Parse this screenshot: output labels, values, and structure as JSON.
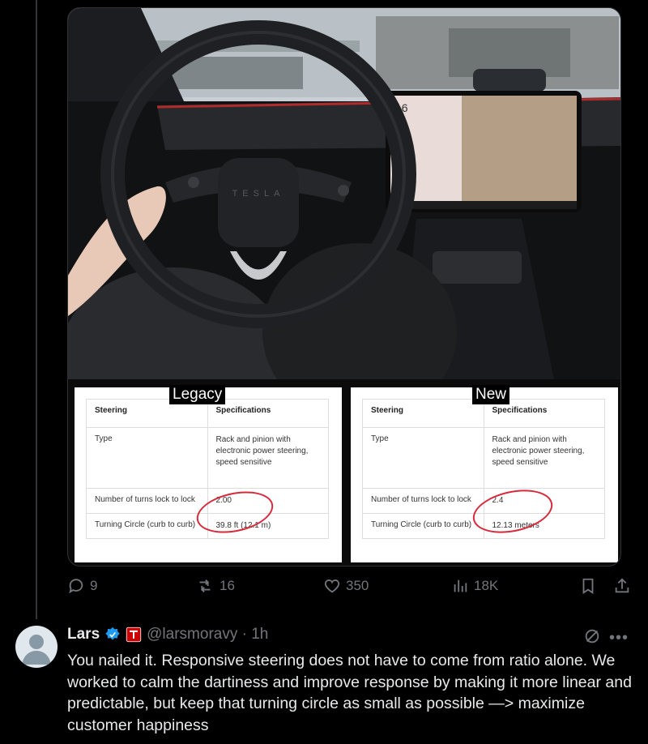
{
  "tweet": {
    "media": {
      "photo_alt": "Tesla steering wheel interior",
      "wheel_logo": "TESLA",
      "screen_speed": "16",
      "left_table": {
        "tag": "Legacy",
        "headers": [
          "Steering",
          "Specifications"
        ],
        "rows": [
          [
            "Type",
            "Rack and pinion with electronic power steering, speed sensitive"
          ],
          [
            "Number of turns lock to lock",
            "2.00"
          ],
          [
            "Turning Circle (curb to curb)",
            "39.8 ft (12.1 m)"
          ]
        ]
      },
      "right_table": {
        "tag": "New",
        "headers": [
          "Steering",
          "Specifications"
        ],
        "rows": [
          [
            "Type",
            "Rack and pinion with electronic power steering, speed sensitive"
          ],
          [
            "Number of turns lock to lock",
            "2.4"
          ],
          [
            "Turning Circle (curb to curb)",
            "12.13 meters"
          ]
        ]
      }
    },
    "actions": {
      "replies": "9",
      "reposts": "16",
      "likes": "350",
      "views": "18K"
    }
  },
  "reply": {
    "name": "Lars",
    "handle_time": "@larsmoravy · 1h",
    "text": "You nailed it. Responsive steering does not have to come from ratio alone. We worked to calm the dartiness and improve response by making it more linear and predictable, but keep that turning circle as small as possible —> maximize customer happiness",
    "accent_color": "#1d9bf0",
    "brand_color": "#cc0000"
  }
}
